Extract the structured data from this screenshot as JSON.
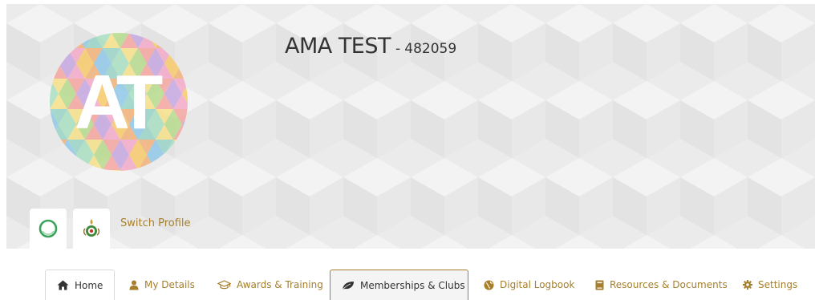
{
  "profile": {
    "initials": "AT",
    "name": "AMA TEST",
    "separator": "-",
    "member_id": "482059",
    "avatar_colors": [
      "#f4a6a0",
      "#f7c96b",
      "#9ad3c7",
      "#b6d98c",
      "#f3a9c9",
      "#8fc8e8",
      "#f6e08a",
      "#c6a6e0",
      "#f2b27a",
      "#a9dfc2"
    ]
  },
  "org_tabs": [
    {
      "icon": "ring-icon",
      "color": "#3aa35a"
    },
    {
      "icon": "wings-badge-icon",
      "color": "#3f8a3a"
    }
  ],
  "switch_profile": {
    "label": "Switch Profile"
  },
  "nav": {
    "items": [
      {
        "label": "Home",
        "icon": "home-icon"
      },
      {
        "label": "My Details",
        "icon": "user-icon"
      },
      {
        "label": "Awards & Training",
        "icon": "graduation-cap-icon"
      },
      {
        "label": "Memberships & Clubs",
        "icon": "leaf-icon"
      },
      {
        "label": "Digital Logbook",
        "icon": "globe-icon"
      },
      {
        "label": "Resources & Documents",
        "icon": "book-icon"
      },
      {
        "label": "Settings",
        "icon": "gear-icon"
      }
    ],
    "active_index": 3
  },
  "colors": {
    "accent": "#a57f2b",
    "banner_bg": "#ebebeb",
    "text_dark": "#333333"
  }
}
